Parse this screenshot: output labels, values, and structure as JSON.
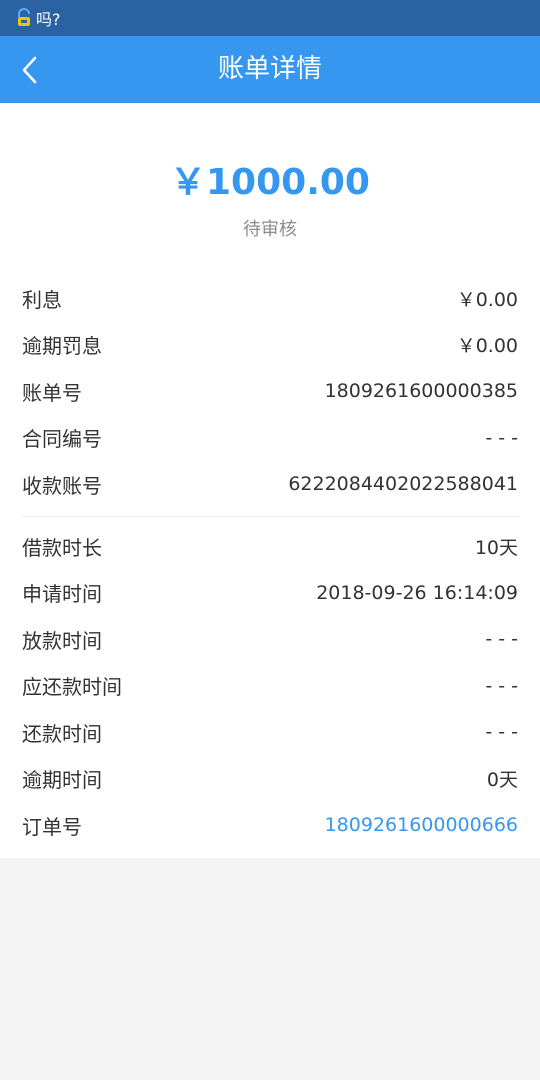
{
  "status_bar": {
    "text": "吗?"
  },
  "nav": {
    "title": "账单详情",
    "back_icon": "chevron-left-icon"
  },
  "summary": {
    "amount": "￥1000.00",
    "status": "待审核"
  },
  "details_1": [
    {
      "label": "利息",
      "value": "￥0.00"
    },
    {
      "label": "逾期罚息",
      "value": "￥0.00"
    },
    {
      "label": "账单号",
      "value": "1809261600000385"
    },
    {
      "label": "合同编号",
      "value": "- - -"
    },
    {
      "label": "收款账号",
      "value": "6222084402022588041"
    }
  ],
  "details_2": [
    {
      "label": "借款时长",
      "value": "10天"
    },
    {
      "label": "申请时间",
      "value": "2018-09-26 16:14:09"
    },
    {
      "label": "放款时间",
      "value": "- - -"
    },
    {
      "label": "应还款时间",
      "value": "- - -"
    },
    {
      "label": "还款时间",
      "value": "- - -"
    },
    {
      "label": "逾期时间",
      "value": "0天"
    },
    {
      "label": "订单号",
      "value": "1809261600000666"
    }
  ],
  "colors": {
    "status_bar": "#2a62a3",
    "nav_bar": "#3597f0",
    "accent": "#3597f0",
    "background": "#f3f3f3"
  }
}
